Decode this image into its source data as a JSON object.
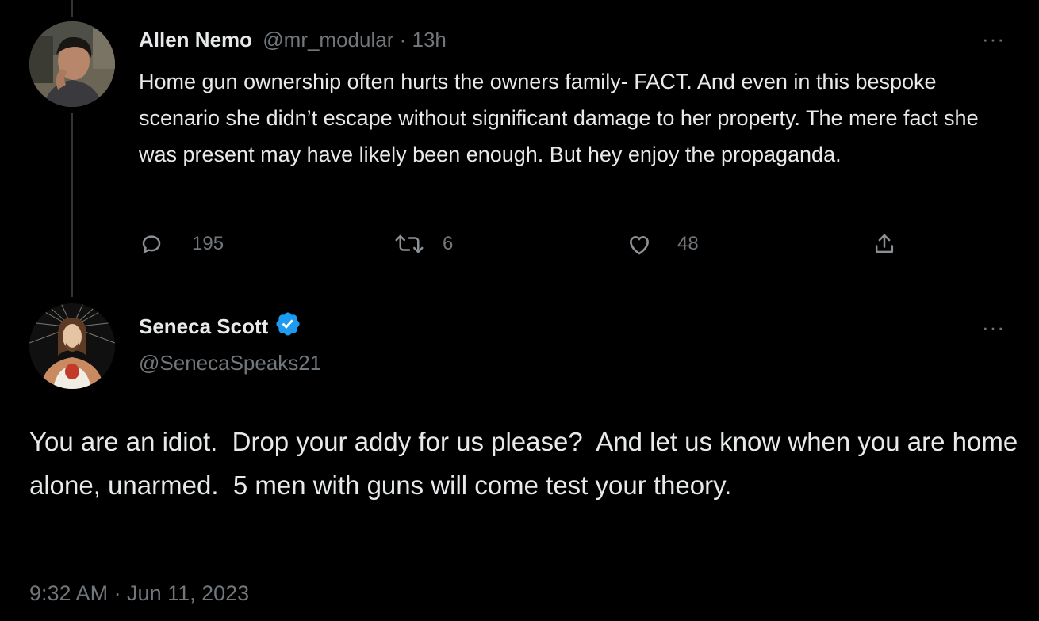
{
  "reply": {
    "author_name": "Allen Nemo",
    "handle": "@mr_modular",
    "separator": "·",
    "time_ago": "13h",
    "more_label": "···",
    "text": "Home gun ownership often hurts the owners family- FACT. And even in this bespoke scenario she didn’t escape without significant damage to her property. The mere fact she was present may have likely been enough. But hey enjoy the propaganda.",
    "actions": {
      "replies": "195",
      "retweets": "6",
      "likes": "48"
    }
  },
  "main": {
    "author_name": "Seneca Scott",
    "handle": "@SenecaSpeaks21",
    "verified": true,
    "more_label": "···",
    "text": "You are an idiot.  Drop your addy for us please?  And let us know when you are home alone, unarmed.  5 men with guns will come test your theory.",
    "timestamp": "9:32 AM · Jun 11, 2023"
  },
  "colors": {
    "background": "#000000",
    "text": "#e7e9ea",
    "muted": "#71767b",
    "verified": "#1d9bf0",
    "thread_line": "#333639"
  }
}
